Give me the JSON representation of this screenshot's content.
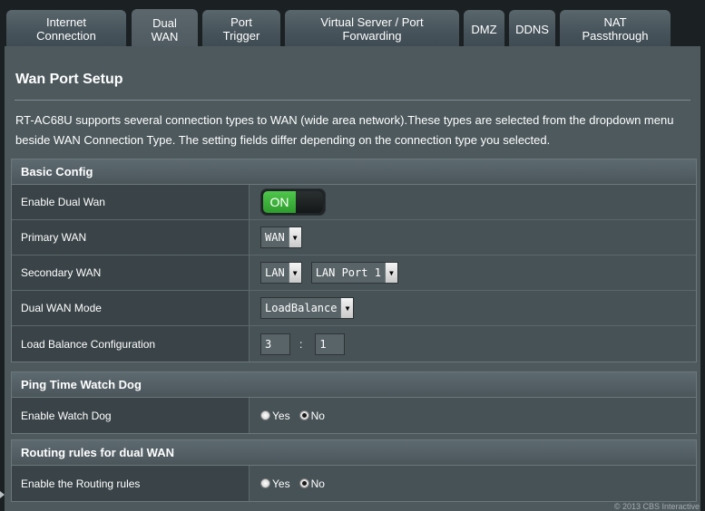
{
  "tabs": [
    {
      "line1": "Internet",
      "line2": "Connection"
    },
    {
      "line1": "Dual",
      "line2": "WAN"
    },
    {
      "line1": "Port",
      "line2": "Trigger"
    },
    {
      "line1": "Virtual Server / Port",
      "line2": "Forwarding"
    },
    {
      "line1": "DMZ",
      "line2": ""
    },
    {
      "line1": "DDNS",
      "line2": ""
    },
    {
      "line1": "NAT",
      "line2": "Passthrough"
    }
  ],
  "page": {
    "title": "Wan Port Setup",
    "description": "RT-AC68U supports several connection types to WAN (wide area network).These types are selected from the dropdown menu beside WAN Connection Type. The setting fields differ depending on the connection type you selected."
  },
  "basic_config": {
    "header": "Basic Config",
    "enable_dual_wan": {
      "label": "Enable Dual Wan",
      "state": "ON"
    },
    "primary_wan": {
      "label": "Primary WAN",
      "value": "WAN"
    },
    "secondary_wan": {
      "label": "Secondary WAN",
      "value": "LAN",
      "port": "LAN Port 1"
    },
    "dual_wan_mode": {
      "label": "Dual WAN Mode",
      "value": "LoadBalance"
    },
    "load_balance": {
      "label": "Load Balance Configuration",
      "ratio_a": "3",
      "separator": ":",
      "ratio_b": "1"
    }
  },
  "ping_watchdog": {
    "header": "Ping Time Watch Dog",
    "enable": {
      "label": "Enable Watch Dog",
      "yes": "Yes",
      "no": "No",
      "selected": "No"
    }
  },
  "routing_rules": {
    "header": "Routing rules for dual WAN",
    "enable": {
      "label": "Enable the Routing rules",
      "yes": "Yes",
      "no": "No",
      "selected": "No"
    }
  },
  "footer": {
    "copyright": "© 2013 CBS Interactive"
  },
  "colors": {
    "toggle_on": "#3cb43a",
    "panel": "#4d595d",
    "background": "#1b2023"
  }
}
